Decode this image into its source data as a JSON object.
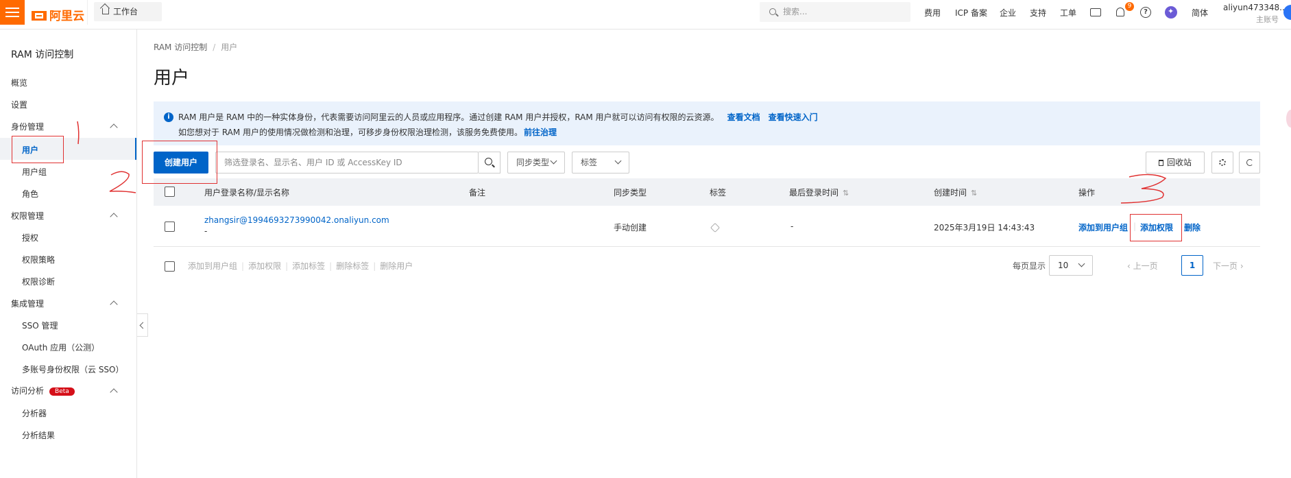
{
  "topbar": {
    "logo": "阿里云",
    "workbench": "工作台",
    "search_placeholder": "搜索...",
    "nav": [
      "费用",
      "ICP 备案",
      "企业",
      "支持",
      "工单"
    ],
    "notification_count": "9",
    "help_glyph": "?",
    "language": "简体",
    "account_name": "aliyun473348...",
    "account_role": "主账号"
  },
  "sidebar": {
    "title": "RAM 访问控制",
    "items": [
      {
        "label": "概览",
        "level": 1
      },
      {
        "label": "设置",
        "level": 1
      },
      {
        "label": "身份管理",
        "level": 1,
        "group": true
      },
      {
        "label": "用户",
        "level": 2,
        "active": true
      },
      {
        "label": "用户组",
        "level": 2
      },
      {
        "label": "角色",
        "level": 2
      },
      {
        "label": "权限管理",
        "level": 1,
        "group": true
      },
      {
        "label": "授权",
        "level": 2
      },
      {
        "label": "权限策略",
        "level": 2
      },
      {
        "label": "权限诊断",
        "level": 2
      },
      {
        "label": "集成管理",
        "level": 1,
        "group": true
      },
      {
        "label": "SSO 管理",
        "level": 2
      },
      {
        "label": "OAuth 应用（公测）",
        "level": 2
      },
      {
        "label": "多账号身份权限（云 SSO）",
        "level": 2
      },
      {
        "label": "访问分析",
        "level": 1,
        "group": true,
        "badge": "Beta"
      },
      {
        "label": "分析器",
        "level": 2
      },
      {
        "label": "分析结果",
        "level": 2
      }
    ]
  },
  "main": {
    "breadcrumb": [
      "RAM 访问控制",
      "用户"
    ],
    "breadcrumb_sep": "/",
    "title": "用户",
    "info": {
      "icon_glyph": "i",
      "line1": "RAM 用户是 RAM 中的一种实体身份，代表需要访问阿里云的人员或应用程序。通过创建 RAM 用户并授权，RAM 用户就可以访问有权限的云资源。",
      "link1": "查看文档",
      "link2": "查看快速入门",
      "line2": "如您想对于 RAM 用户的使用情况做检测和治理，可移步身份权限治理检测，该服务免费使用。",
      "link3": "前往治理"
    },
    "toolbar": {
      "create_user": "创建用户",
      "filter_placeholder": "筛选登录名、显示名、用户 ID 或 AccessKey ID",
      "sync_type": "同步类型",
      "tag": "标签",
      "recycle_bin": "回收站"
    },
    "table": {
      "headers": [
        "用户登录名称/显示名称",
        "备注",
        "同步类型",
        "标签",
        "最后登录时间",
        "创建时间",
        "操作"
      ],
      "sort_glyph": "⇅",
      "rows": [
        {
          "login": "zhangsir@1994693273990042.onaliyun.com",
          "display": "-",
          "note": "",
          "sync": "手动创建",
          "last_login": "-",
          "created": "2025年3月19日 14:43:43",
          "actions": [
            "添加到用户组",
            "添加权限",
            "删除"
          ]
        }
      ]
    },
    "bulk_actions": [
      "添加到用户组",
      "添加权限",
      "添加标签",
      "删除标签",
      "删除用户"
    ],
    "pager": {
      "per_page_label": "每页显示",
      "per_page": "10",
      "prev": "上一页",
      "current": "1",
      "next": "下一页"
    }
  },
  "colors": {
    "brand": "#ff6a00",
    "primary": "#0064c8",
    "annotation": "#e03030"
  }
}
